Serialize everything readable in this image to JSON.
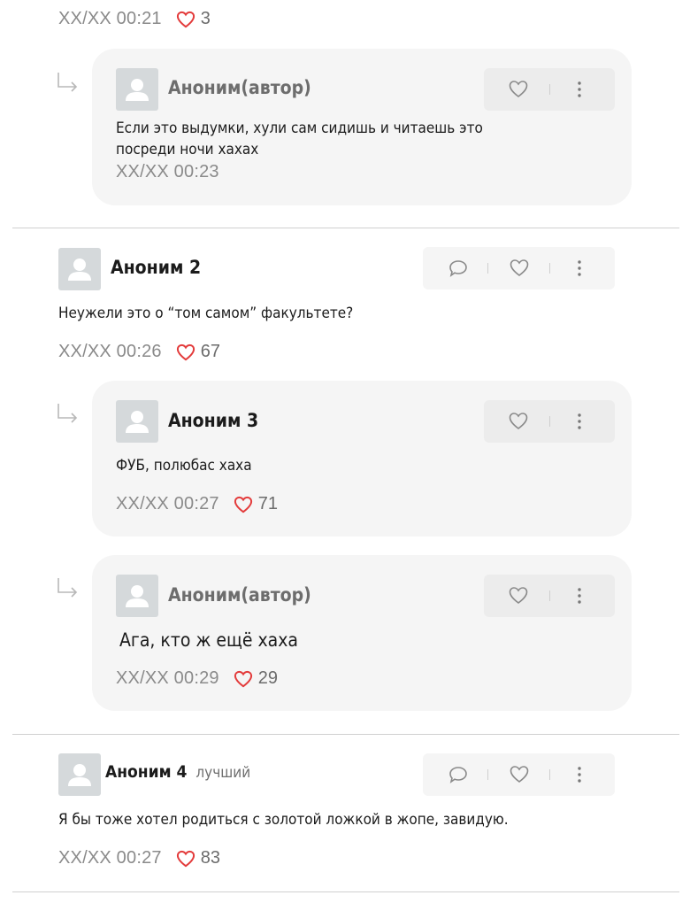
{
  "top": {
    "time": "XX/XX 00:21",
    "likes": "3"
  },
  "threads": [
    {
      "author": "Аноним 2",
      "text": "Неужели это о “том самом” факультете?",
      "time": "XX/XX 00:26",
      "likes": "67"
    },
    {
      "author": "Аноним 4",
      "badge": "лучший",
      "text": "Я бы тоже хотел родиться с золотой ложкой в жопе, завидую.",
      "time": "XX/XX 00:27",
      "likes": "83"
    }
  ],
  "replies": [
    {
      "author": "Аноним(автор)",
      "text": "Если это выдумки, хули сам сидишь и читаешь это посреди ночи хахах",
      "time": "XX/XX 00:23",
      "likes": ""
    },
    {
      "author": "Аноним 3",
      "text": "ФУБ, полюбас хаха",
      "time": "XX/XX 00:27",
      "likes": "71"
    },
    {
      "author": "Аноним(автор)",
      "text": "Ага, кто ж ещё хаха",
      "time": "XX/XX 00:29",
      "likes": "29"
    }
  ],
  "icons": {
    "heart": "heart-outline-red",
    "reply_arrow": "reply-arrow",
    "comment": "speech-bubble",
    "more": "vertical-dots"
  },
  "colors": {
    "heart": "#e33b3b",
    "card": "#f5f5f5",
    "meta": "#8a8a8a"
  }
}
